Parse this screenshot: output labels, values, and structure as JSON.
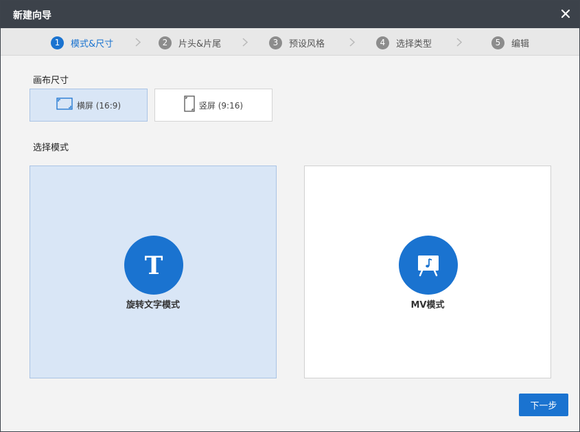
{
  "dialog": {
    "title": "新建向导",
    "close_icon": "close-icon"
  },
  "steps": [
    {
      "num": "1",
      "label": "模式&尺寸",
      "active": true
    },
    {
      "num": "2",
      "label": "片头&片尾",
      "active": false
    },
    {
      "num": "3",
      "label": "预设风格",
      "active": false
    },
    {
      "num": "4",
      "label": "选择类型",
      "active": false
    },
    {
      "num": "5",
      "label": "编辑",
      "active": false
    }
  ],
  "canvas_size": {
    "label": "画布尺寸",
    "options": [
      {
        "label": "横屏 (16:9)",
        "icon": "landscape-icon",
        "selected": true
      },
      {
        "label": "竖屏 (9:16)",
        "icon": "portrait-icon",
        "selected": false
      }
    ]
  },
  "mode": {
    "label": "选择模式",
    "options": [
      {
        "label": "旋转文字模式",
        "icon": "text-t-icon",
        "selected": true
      },
      {
        "label": "MV模式",
        "icon": "music-board-icon",
        "selected": false
      }
    ]
  },
  "footer": {
    "next_label": "下一步"
  },
  "colors": {
    "accent": "#1a73d0",
    "titlebar": "#3c424a",
    "selected_bg": "#d9e6f6"
  }
}
